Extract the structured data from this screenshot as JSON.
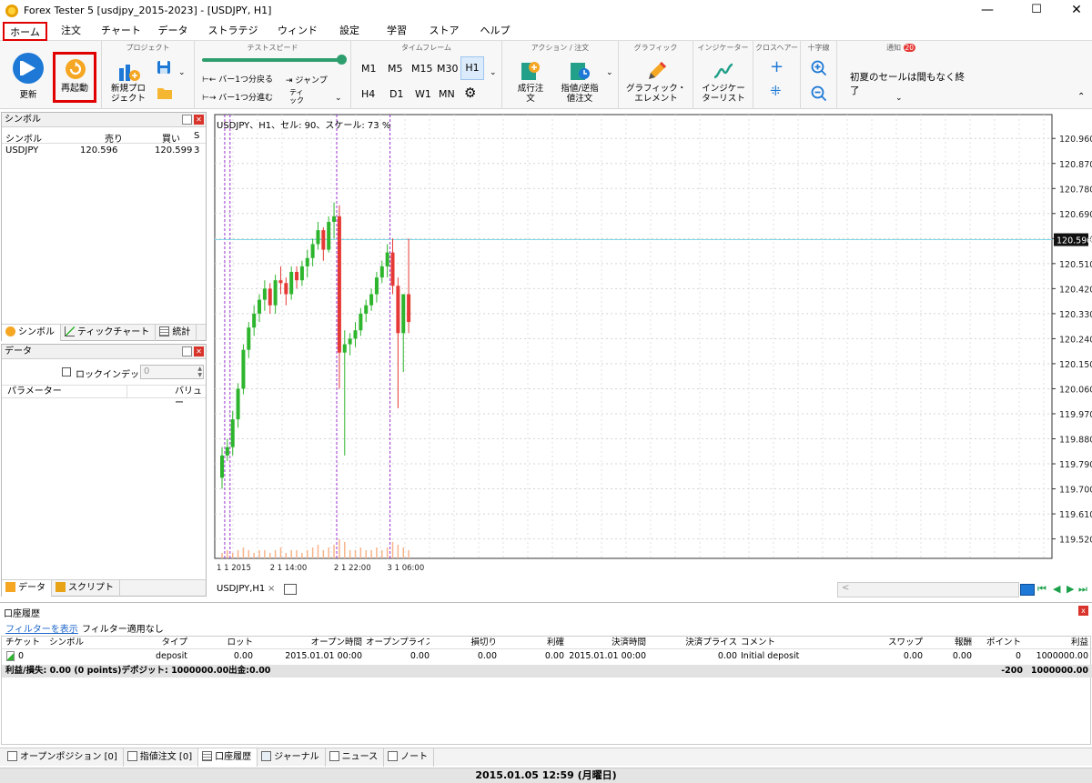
{
  "window": {
    "title": "Forex Tester 5  [usdjpy_2015-2023] - [USDJPY, H1]",
    "minimize": "—",
    "maximize": "☐",
    "close": "✕"
  },
  "menu": [
    "ホーム",
    "注文",
    "チャート",
    "データ",
    "ストラテジー",
    "ウィンドウ",
    "設定",
    "学習",
    "ストア",
    "ヘルプ"
  ],
  "ribbon": {
    "update_label": "更新",
    "restart_label": "再起動",
    "project_group": "プロジェクト",
    "new_project_label": "新規プロ\nジェクト",
    "speed_group": "テストスピード",
    "back_bar": "バー1つ分戻る",
    "fwd_bar": "バー1つ分進む",
    "jump": "ジャンプ",
    "tick": "ティ\nック",
    "timeframe_group": "タイムフレーム",
    "timeframes": [
      "M1",
      "M5",
      "M15",
      "M30",
      "H1",
      "H4",
      "D1",
      "W1",
      "MN"
    ],
    "action_group": "アクション / 注文",
    "market_order": "成行注\n文",
    "pending_order": "指値/逆指\n値注文",
    "graphic_group": "グラフィック",
    "graphic_elem": "グラフィック・\nエレメント",
    "indicator_group": "インジケーター",
    "indicator_list": "インジケー\nターリスト",
    "crosshair_group": "クロスヘアー",
    "zoom_group": "十字線",
    "notice_group": "通知",
    "notice_count": "20",
    "notice_text": "初夏のセールは間もなく終了"
  },
  "symbol_panel": {
    "title": "シンボル",
    "headers": [
      "シンボル",
      "売り",
      "買い",
      "S"
    ],
    "rows": [
      [
        "USDJPY",
        "120.596",
        "120.599",
        "3"
      ]
    ],
    "tabs": [
      "シンボル",
      "ティックチャート",
      "統計"
    ]
  },
  "data_panel": {
    "title": "データ",
    "lock_label": "ロックインデックス:",
    "lock_value": "0",
    "headers": [
      "パラメーター",
      "バリュー"
    ],
    "tabs": [
      "データ",
      "スクリプト"
    ]
  },
  "chart": {
    "info": "USDJPY、H1、セル: 90、スケール: 73 %",
    "tab_label": "USDJPY,H1",
    "tab_close": "×",
    "scroll_left": "<",
    "current_price": "120.596",
    "x_labels": [
      "1 1 2015",
      "2 1 14:00",
      "2 1 22:00",
      "3 1 06:00"
    ]
  },
  "chart_data": {
    "type": "candlestick",
    "symbol": "USDJPY",
    "ylim": [
      119.45,
      121.0
    ],
    "yticks": [
      120.96,
      120.87,
      120.78,
      120.69,
      120.6,
      120.51,
      120.42,
      120.33,
      120.24,
      120.15,
      120.06,
      119.97,
      119.88,
      119.79,
      119.7,
      119.61,
      119.52
    ],
    "current_price": 120.596,
    "candles": [
      [
        119.74,
        119.85,
        119.7,
        119.82
      ],
      [
        119.82,
        119.88,
        119.8,
        119.85
      ],
      [
        119.85,
        119.98,
        119.82,
        119.95
      ],
      [
        119.95,
        120.08,
        119.92,
        120.06
      ],
      [
        120.06,
        120.22,
        120.04,
        120.2
      ],
      [
        120.2,
        120.3,
        120.17,
        120.28
      ],
      [
        120.28,
        120.36,
        120.25,
        120.33
      ],
      [
        120.33,
        120.4,
        120.3,
        120.38
      ],
      [
        120.38,
        120.45,
        120.34,
        120.42
      ],
      [
        120.42,
        120.44,
        120.33,
        120.36
      ],
      [
        120.36,
        120.47,
        120.33,
        120.45
      ],
      [
        120.45,
        120.5,
        120.4,
        120.44
      ],
      [
        120.44,
        120.46,
        120.36,
        120.4
      ],
      [
        120.4,
        120.5,
        120.38,
        120.48
      ],
      [
        120.48,
        120.5,
        120.42,
        120.45
      ],
      [
        120.45,
        120.52,
        120.43,
        120.5
      ],
      [
        120.5,
        120.56,
        120.46,
        120.53
      ],
      [
        120.53,
        120.6,
        120.5,
        120.58
      ],
      [
        120.58,
        120.66,
        120.56,
        120.63
      ],
      [
        120.63,
        120.64,
        120.52,
        120.56
      ],
      [
        120.56,
        120.68,
        120.55,
        120.66
      ],
      [
        120.66,
        120.73,
        120.6,
        120.68
      ],
      [
        120.68,
        120.72,
        120.06,
        120.19
      ],
      [
        120.19,
        120.27,
        119.82,
        120.22
      ],
      [
        120.22,
        120.26,
        120.18,
        120.24
      ],
      [
        120.24,
        120.3,
        120.21,
        120.27
      ],
      [
        120.27,
        120.35,
        120.25,
        120.33
      ],
      [
        120.33,
        120.38,
        120.3,
        120.36
      ],
      [
        120.36,
        120.42,
        120.34,
        120.4
      ],
      [
        120.4,
        120.48,
        120.37,
        120.46
      ],
      [
        120.46,
        120.52,
        120.44,
        120.5
      ],
      [
        120.5,
        120.58,
        120.46,
        120.55
      ],
      [
        120.55,
        120.6,
        120.4,
        120.43
      ],
      [
        120.43,
        120.46,
        119.99,
        120.26
      ],
      [
        120.26,
        120.3,
        120.12,
        120.4
      ],
      [
        120.4,
        120.6,
        120.26,
        120.3
      ]
    ],
    "volumes": [
      2,
      3,
      2,
      3,
      4,
      3,
      2,
      3,
      3,
      2,
      3,
      4,
      2,
      3,
      3,
      2,
      3,
      4,
      5,
      3,
      4,
      5,
      7,
      6,
      3,
      3,
      4,
      3,
      3,
      4,
      3,
      4,
      6,
      5,
      4,
      3
    ],
    "session_lines": [
      1,
      2,
      22,
      32
    ]
  },
  "history": {
    "title": "口座履歴",
    "filter_link": "フィルターを表示",
    "filter_status": "フィルター適用なし",
    "headers": [
      "チケット",
      "シンボル",
      "タイプ",
      "ロット",
      "オープン時間",
      "オープンプライス",
      "損切り",
      "利確",
      "決済時間",
      "決済プライス",
      "コメント",
      "スワップ",
      "報酬",
      "ポイント",
      "利益"
    ],
    "rows": [
      [
        "0",
        "",
        "deposit",
        "0.00",
        "2015.01.01 00:00",
        "0.00",
        "0.00",
        "0.00",
        "2015.01.01 00:00",
        "0.00",
        "Initial deposit",
        "0.00",
        "0.00",
        "0",
        "1000000.00"
      ]
    ],
    "summary": "利益/損失: 0.00 (0 points)デポジット: 1000000.00出金:0.00",
    "summary_points": "-200",
    "summary_total": "1000000.00",
    "close": "x"
  },
  "bottom_tabs": [
    "オープンポジション [0]",
    "指値注文 [0]",
    "口座履歴",
    "ジャーナル",
    "ニュース",
    "ノート"
  ],
  "status": "2015.01.05 12:59 (月曜日)",
  "colors": {
    "bull": "#2db52d",
    "bear": "#e53935",
    "price_line": "#7fd8e8",
    "session": "#9b30d0",
    "highlight": "#e00000",
    "volume": "#f7b48a"
  }
}
